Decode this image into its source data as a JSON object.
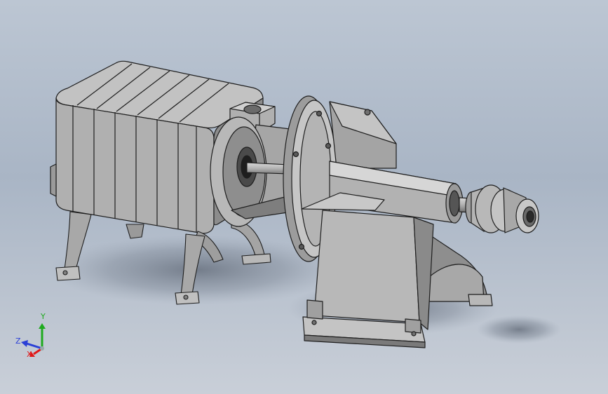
{
  "triad": {
    "y_label": "Y",
    "z_label": "Z",
    "x_label": "X",
    "colors": {
      "y": "#1faa1f",
      "z": "#2a3fd6",
      "x": "#e01818"
    }
  }
}
